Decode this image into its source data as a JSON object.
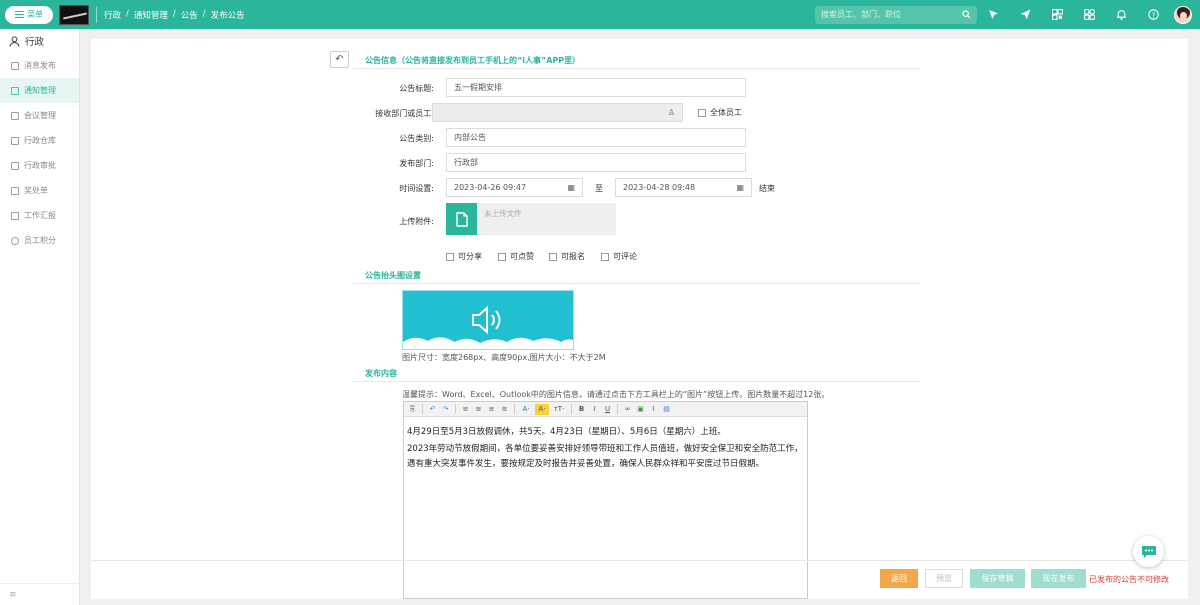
{
  "topbar": {
    "menu_label": "菜单",
    "breadcrumb": [
      "行政",
      "通知管理",
      "公告",
      "发布公告"
    ],
    "breadcrumb_sep": "/",
    "search_placeholder": "搜索员工、部门、职位",
    "icons": [
      "cursor-icon",
      "send-icon",
      "qrcode-icon",
      "apps-icon",
      "bell-icon",
      "help-icon"
    ],
    "accent_color": "#2bb59a"
  },
  "sidebar": {
    "title": "行政",
    "items": [
      {
        "label": "消息发布",
        "icon": "megaphone-icon",
        "active": false
      },
      {
        "label": "通知管理",
        "icon": "notice-icon",
        "active": true
      },
      {
        "label": "会议管理",
        "icon": "meeting-icon",
        "active": false
      },
      {
        "label": "行政仓库",
        "icon": "warehouse-icon",
        "active": false
      },
      {
        "label": "行政审批",
        "icon": "approval-icon",
        "active": false
      },
      {
        "label": "奖处单",
        "icon": "award-icon",
        "active": false
      },
      {
        "label": "工作汇报",
        "icon": "report-icon",
        "active": false
      },
      {
        "label": "员工积分",
        "icon": "points-icon",
        "active": false
      }
    ]
  },
  "form": {
    "section_info_title": "公告信息（公告将直接发布到员工手机上的“i人事”APP里）",
    "title_label": "公告标题:",
    "title_value": "五一假期安排",
    "recipients_label": "接收部门或员工:",
    "recipients_value": "",
    "all_staff_label": "全体员工",
    "category_label": "公告类别:",
    "category_value": "内部公告",
    "dept_label": "发布部门:",
    "dept_value": "行政部",
    "time_label": "时间设置:",
    "start_time": "2023-04-26 09:47",
    "to_label": "至",
    "end_time": "2023-04-28 09:48",
    "end_label": "结束",
    "attach_label": "上传附件:",
    "attach_placeholder": "未上传文件",
    "options": [
      "可分享",
      "可点赞",
      "可报名",
      "可评论"
    ],
    "section_header_img_title": "公告抬头图设置",
    "img_size_tip": "图片尺寸：宽度268px、高度90px,图片大小：不大于2M",
    "section_content_title": "发布内容",
    "content_tip": "温馨提示：Word、Excel、Outlook中的图片信息，请通过点击下方工具栏上的“图片”按钮上传。图片数量不超过12张。",
    "content_lines": [
      "4月29日至5月3日放假调休，共5天。4月23日（星期日）、5月6日（星期六）上班。",
      "2023年劳动节放假期间，各单位要妥善安排好领导带班和工作人员值班，做好安全保卫和安全防范工作，遇有重大突发事件发生，要按规定及时报告并妥善处置，确保人民群众祥和平安度过节日假期。"
    ]
  },
  "footer": {
    "back_label": "返回",
    "preview_label": "预览",
    "save_draft_label": "保存草稿",
    "publish_label": "现在发布",
    "warning": "已发布的公告不可修改"
  }
}
